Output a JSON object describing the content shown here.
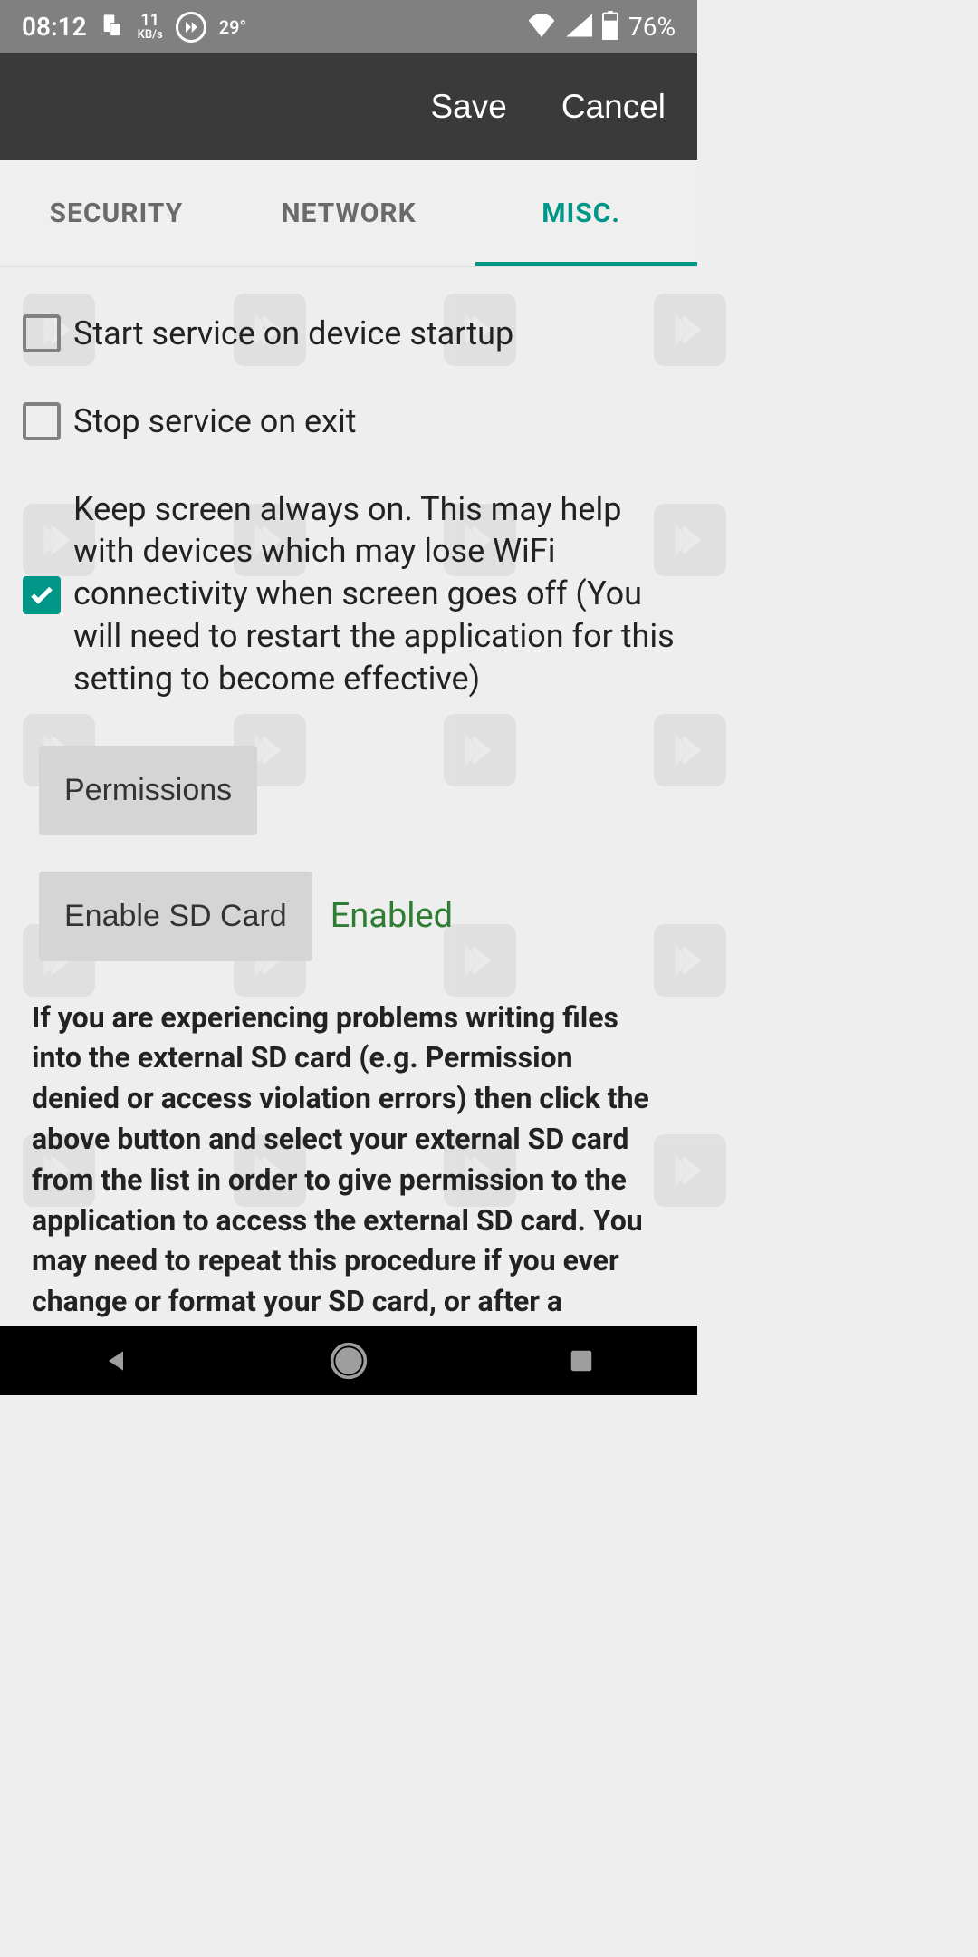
{
  "status": {
    "time": "08:12",
    "speed_num": "11",
    "speed_label": "KB/s",
    "temp": "29°",
    "battery": "76%"
  },
  "actions": {
    "save": "Save",
    "cancel": "Cancel"
  },
  "tabs": [
    {
      "label": "SECURITY"
    },
    {
      "label": "NETWORK"
    },
    {
      "label": "MISC."
    }
  ],
  "settings": {
    "startup": {
      "label": "Start service on device startup",
      "checked": false
    },
    "stopexit": {
      "label": "Stop service on exit",
      "checked": false
    },
    "keepscreen": {
      "label": "Keep screen always on. This may help with devices which may lose WiFi connectivity when screen goes off (You will need to restart the application for this setting to become effective)",
      "checked": true
    }
  },
  "buttons": {
    "permissions": "Permissions",
    "enable_sd": "Enable SD Card",
    "sd_status": "Enabled"
  },
  "help": "If you are experiencing problems writing files into the external SD card (e.g. Permission denied or access violation errors) then click the above button and select your external SD card from the list in order to give permission to the application to access the external SD card. You may need to repeat this procedure if you ever change or format your SD card, or after a software upgrade."
}
